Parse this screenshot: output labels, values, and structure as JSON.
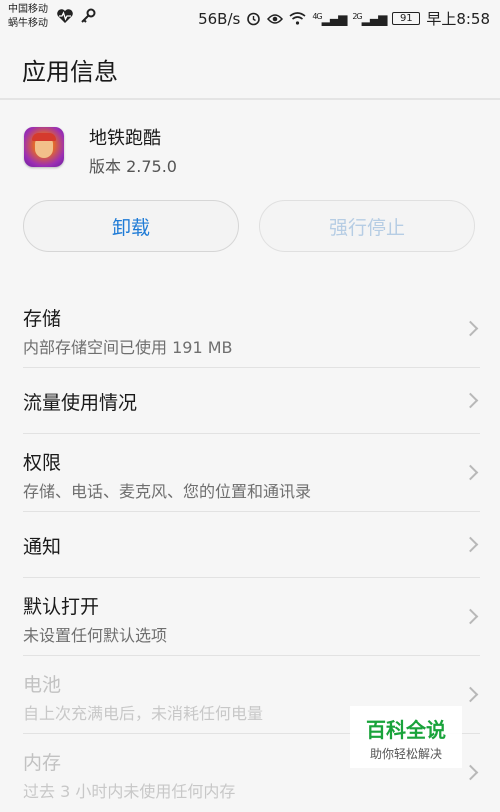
{
  "status_bar": {
    "carrier1": "中国移动",
    "carrier2": "蜗牛移动",
    "left_icons": [
      "heart-rate-icon",
      "key-icon"
    ],
    "speed": "56B/s",
    "net1": "4G",
    "net2": "2G",
    "battery": "91",
    "time": "早上8:58"
  },
  "app_bar": {
    "title": "应用信息"
  },
  "app": {
    "name": "地铁跑酷",
    "version": "版本 2.75.0"
  },
  "buttons": {
    "uninstall": "卸载",
    "force_stop": "强行停止"
  },
  "items": [
    {
      "title": "存储",
      "subtitle": "内部存储空间已使用 191 MB",
      "enabled": true
    },
    {
      "title": "流量使用情况",
      "subtitle": "",
      "enabled": true
    },
    {
      "title": "权限",
      "subtitle": "存储、电话、麦克风、您的位置和通讯录",
      "enabled": true
    },
    {
      "title": "通知",
      "subtitle": "",
      "enabled": true
    },
    {
      "title": "默认打开",
      "subtitle": "未设置任何默认选项",
      "enabled": true
    },
    {
      "title": "电池",
      "subtitle": "自上次充满电后，未消耗任何电量",
      "enabled": false
    },
    {
      "title": "内存",
      "subtitle": "过去 3 小时内未使用任何内存",
      "enabled": false
    }
  ],
  "watermark": {
    "title": "百科全说",
    "subtitle": "助你轻松解决"
  },
  "colors": {
    "accent": "#1f7bd6",
    "disabled_button_text": "#b6cde4",
    "watermark_green": "#19a33b"
  }
}
